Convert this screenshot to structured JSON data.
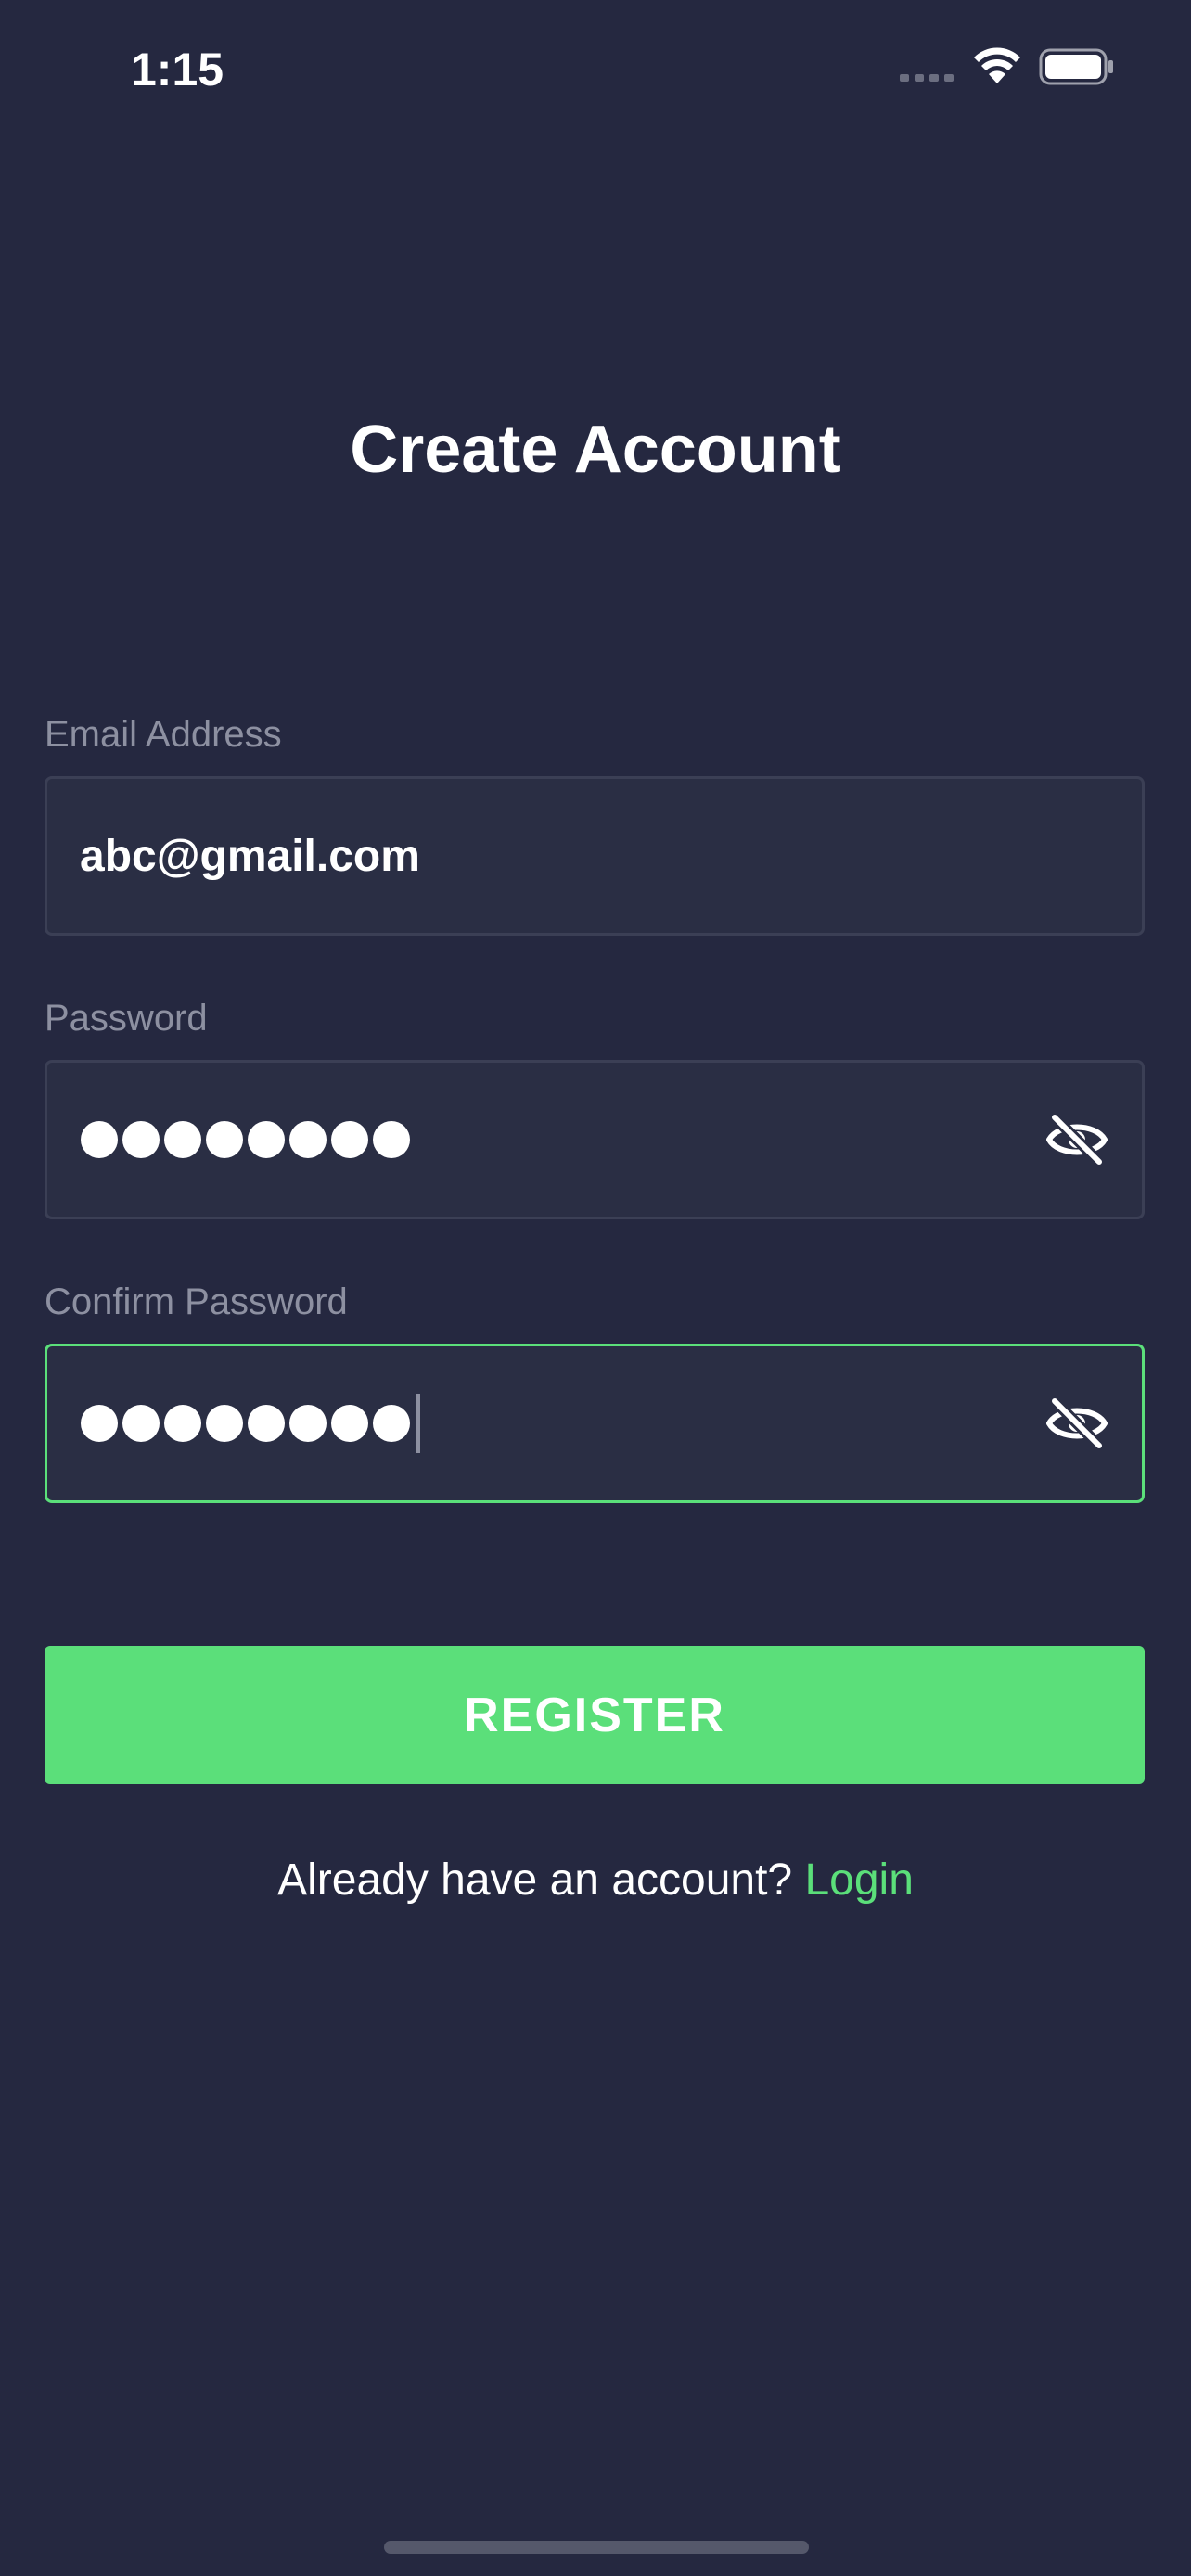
{
  "status_bar": {
    "time": "1:15"
  },
  "title": "Create Account",
  "form": {
    "email": {
      "label": "Email Address",
      "value": "abc@gmail.com"
    },
    "password": {
      "label": "Password",
      "masked_length": 8,
      "toggle_icon": "eye-slash-icon"
    },
    "confirm_password": {
      "label": "Confirm Password",
      "masked_length": 8,
      "focused": true,
      "toggle_icon": "eye-slash-icon"
    }
  },
  "register_button": {
    "label": "REGISTER"
  },
  "footer": {
    "prompt": "Already have an account?",
    "login_link": "Login"
  },
  "colors": {
    "background": "#252840",
    "input_background": "#2a2e44",
    "accent": "#5bdf7a",
    "label": "#8d90a1"
  }
}
